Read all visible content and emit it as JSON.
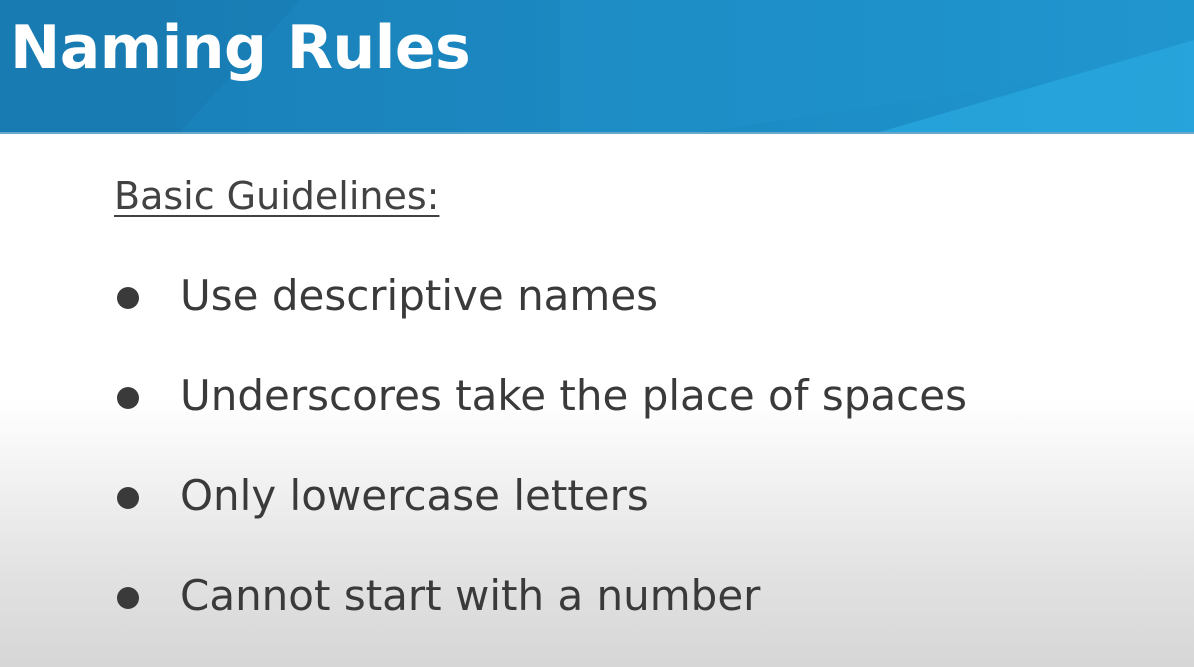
{
  "slide": {
    "title": "Naming Rules",
    "subheading": "Basic Guidelines:",
    "bullets": [
      "Use descriptive names",
      "Underscores take the place of spaces",
      "Only lowercase letters",
      "Cannot start with a number"
    ]
  },
  "colors": {
    "header_blue": "#1b86bf",
    "header_accent": "#2aa6dc",
    "title_text": "#ffffff",
    "body_text": "#3a3a3a"
  }
}
